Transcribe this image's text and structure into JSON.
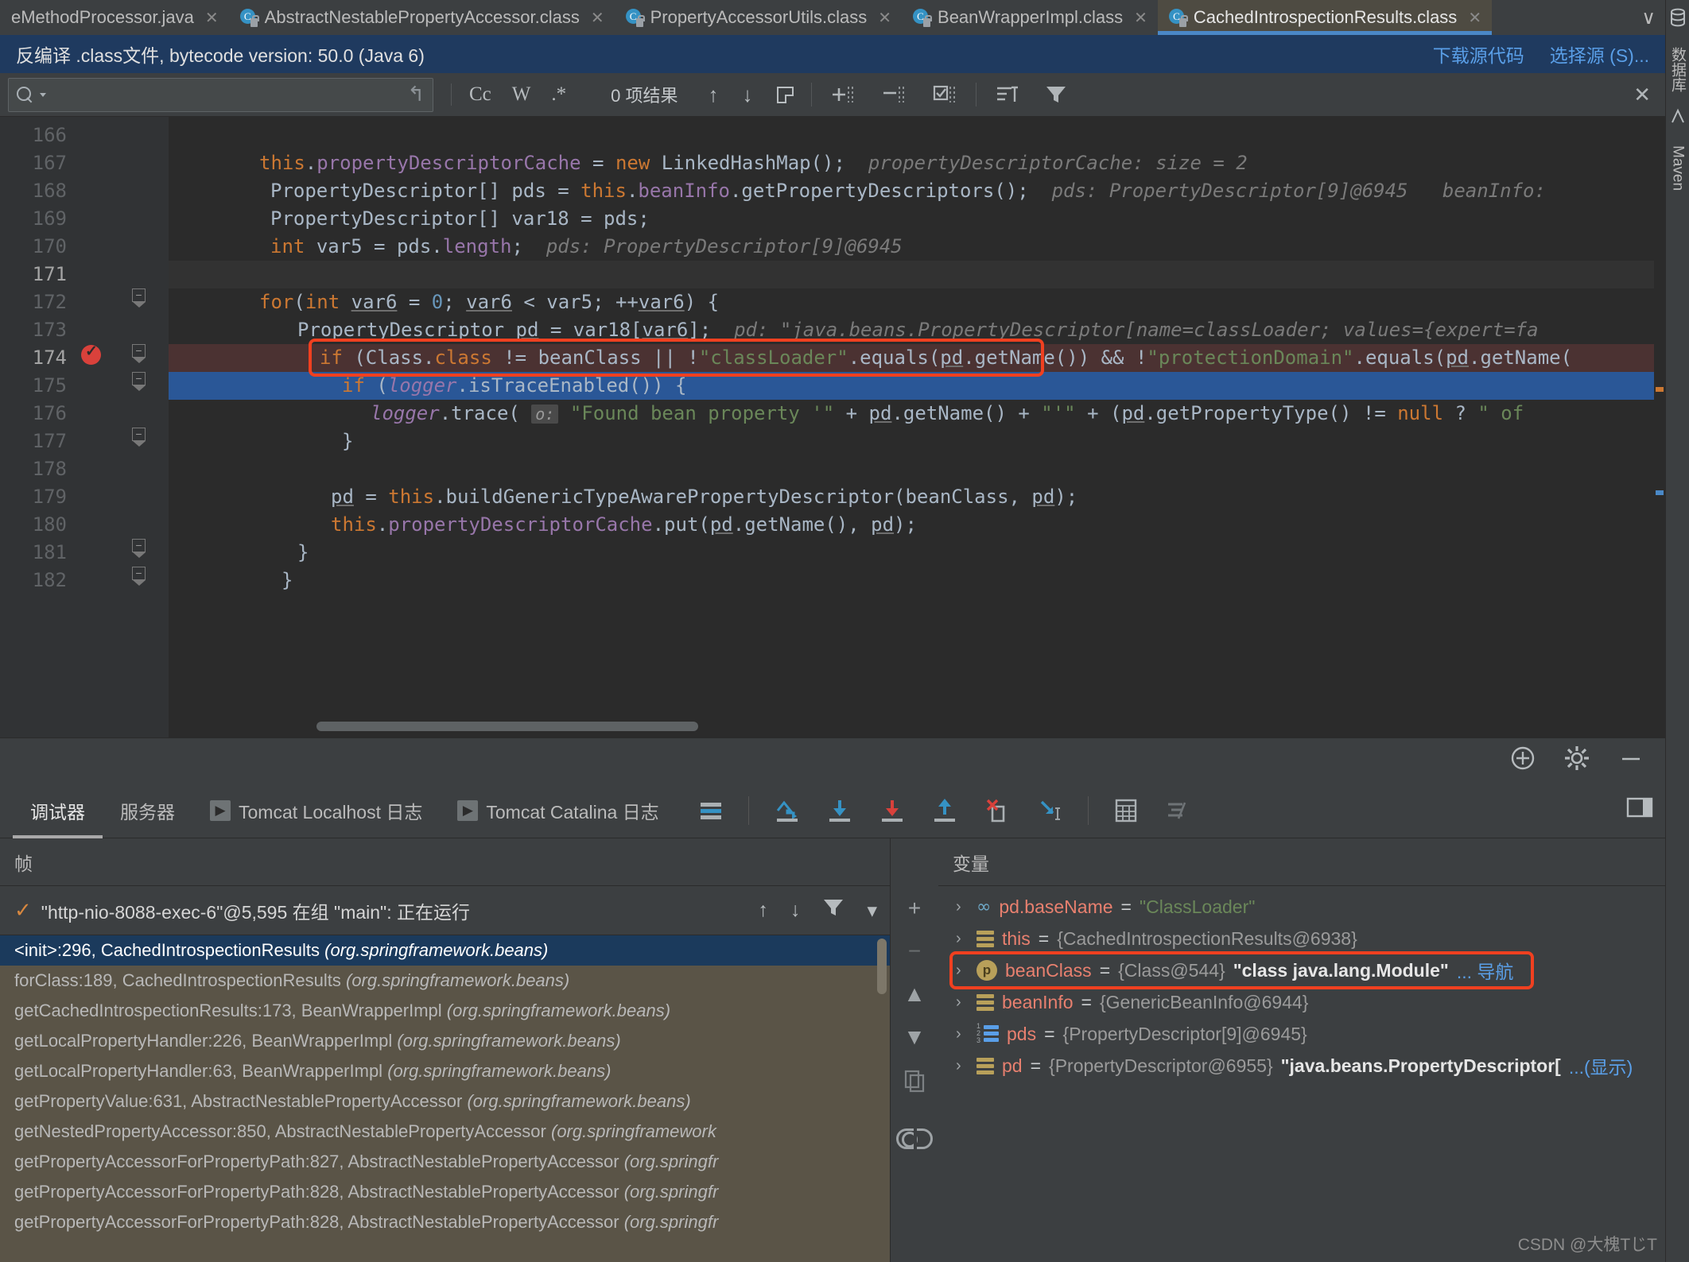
{
  "tabs": [
    {
      "label": "eMethodProcessor.java",
      "icon": "java-file-icon",
      "active": false,
      "hasIcon": false
    },
    {
      "label": "AbstractNestablePropertyAccessor.class",
      "icon": "class-file-icon",
      "active": false,
      "hasIcon": true
    },
    {
      "label": "PropertyAccessorUtils.class",
      "icon": "class-file-icon",
      "active": false,
      "hasIcon": true
    },
    {
      "label": "BeanWrapperImpl.class",
      "icon": "class-file-icon",
      "active": false,
      "hasIcon": true
    },
    {
      "label": "CachedIntrospectionResults.class",
      "icon": "class-file-icon",
      "active": true,
      "hasIcon": true
    }
  ],
  "tabbar": {
    "overflow_glyph": "∨",
    "close_glyph": "✕",
    "class_icon_letter": "C"
  },
  "notification": {
    "message": "反编译 .class文件, bytecode version: 50.0 (Java 6)",
    "actions": [
      "下载源代码",
      "选择源 (S)..."
    ]
  },
  "find": {
    "value": "",
    "placeholder": "",
    "wrap_glyph": "↰",
    "match_case": "Cc",
    "words": "W",
    "regex": ".*",
    "results": "0 项结果",
    "prev_glyph": "↑",
    "next_glyph": "↓",
    "select_all_glyph": "select-all-icon",
    "close_glyph": "✕"
  },
  "editor": {
    "first_line": 166,
    "lines": [
      {
        "n": 166,
        "html": "",
        "state": "normal"
      },
      {
        "n": 167,
        "html": "L167",
        "state": "normal"
      },
      {
        "n": 168,
        "html": "L168",
        "state": "normal"
      },
      {
        "n": 169,
        "html": "L169",
        "state": "normal"
      },
      {
        "n": 170,
        "html": "L170",
        "state": "normal"
      },
      {
        "n": 171,
        "html": "",
        "state": "cursor"
      },
      {
        "n": 172,
        "html": "L172",
        "state": "normal"
      },
      {
        "n": 173,
        "html": "L173",
        "state": "normal"
      },
      {
        "n": 174,
        "html": "L174",
        "state": "breakpoint"
      },
      {
        "n": 175,
        "html": "L175",
        "state": "executing"
      },
      {
        "n": 176,
        "html": "L176",
        "state": "normal"
      },
      {
        "n": 177,
        "html": "L177",
        "state": "normal"
      },
      {
        "n": 178,
        "html": "",
        "state": "normal"
      },
      {
        "n": 179,
        "html": "L179",
        "state": "normal"
      },
      {
        "n": 180,
        "html": "L180",
        "state": "normal"
      },
      {
        "n": 181,
        "html": "L181",
        "state": "normal"
      },
      {
        "n": 182,
        "html": "L182",
        "state": "normal"
      }
    ],
    "code_text": {
      "l167": "this.propertyDescriptorCache = new LinkedHashMap();",
      "l167_hint": "propertyDescriptorCache:  size = 2",
      "l168": "PropertyDescriptor[] pds = this.beanInfo.getPropertyDescriptors();",
      "l168_hint": "pds: PropertyDescriptor[9]@6945",
      "l168_hint2": "beanInfo:",
      "l169": "PropertyDescriptor[] var18 = pds;",
      "l170": "int var5 = pds.length;",
      "l170_hint": "pds: PropertyDescriptor[9]@6945",
      "l172": "for(int var6 = 0; var6 < var5; ++var6) {",
      "l173": "PropertyDescriptor pd = var18[var6];",
      "l173_hint": "pd: \"java.beans.PropertyDescriptor[name=classLoader; values={expert=fa",
      "l174": "if (Class.class != beanClass || !\"classLoader\".equals(pd.getName()) && !\"protectionDomain\".equals(pd.getName(",
      "l175": "if (logger.isTraceEnabled()) {",
      "l176": "logger.trace( o: \"Found bean property '\" + pd.getName() + \"'\" + (pd.getPropertyType() != null ? \" of",
      "l177": "}",
      "l179": "pd = this.buildGenericTypeAwarePropertyDescriptor(beanClass, pd);",
      "l180": "this.propertyDescriptorCache.put(pd.getName(), pd);",
      "l181": "}",
      "l182": "}"
    }
  },
  "debug": {
    "toolbar_icons": [
      "add-watch-icon",
      "settings-gear-icon",
      "minimize-icon"
    ],
    "tabs": [
      {
        "label": "调试器",
        "active": true,
        "icon": null
      },
      {
        "label": "服务器",
        "active": false,
        "icon": null
      },
      {
        "label": "Tomcat Localhost 日志",
        "active": false,
        "icon": "run-icon"
      },
      {
        "label": "Tomcat Catalina 日志",
        "active": false,
        "icon": "run-icon"
      }
    ],
    "step_tools": [
      "show-execution-point-icon",
      "step-over-icon",
      "step-into-icon",
      "force-step-into-icon",
      "step-out-icon",
      "drop-frame-icon",
      "run-to-cursor-icon",
      "evaluate-expression-icon",
      "mute-breakpoints-icon"
    ],
    "frames": {
      "header": "帧",
      "thread": "\"http-nio-8088-exec-6\"@5,595 在组 \"main\": 正在运行",
      "thread_tools": [
        "up-arrow-icon",
        "down-arrow-icon",
        "filter-icon",
        "dropdown-icon"
      ],
      "items": [
        {
          "text": "<init>:296, CachedIntrospectionResults ",
          "pkg": "(org.springframework.beans)",
          "selected": true
        },
        {
          "text": "forClass:189, CachedIntrospectionResults ",
          "pkg": "(org.springframework.beans)",
          "selected": false
        },
        {
          "text": "getCachedIntrospectionResults:173, BeanWrapperImpl ",
          "pkg": "(org.springframework.beans)",
          "selected": false
        },
        {
          "text": "getLocalPropertyHandler:226, BeanWrapperImpl ",
          "pkg": "(org.springframework.beans)",
          "selected": false
        },
        {
          "text": "getLocalPropertyHandler:63, BeanWrapperImpl ",
          "pkg": "(org.springframework.beans)",
          "selected": false
        },
        {
          "text": "getPropertyValue:631, AbstractNestablePropertyAccessor ",
          "pkg": "(org.springframework.beans)",
          "selected": false
        },
        {
          "text": "getNestedPropertyAccessor:850, AbstractNestablePropertyAccessor ",
          "pkg": "(org.springframework",
          "selected": false
        },
        {
          "text": "getPropertyAccessorForPropertyPath:827, AbstractNestablePropertyAccessor ",
          "pkg": "(org.springfr",
          "selected": false
        },
        {
          "text": "getPropertyAccessorForPropertyPath:828, AbstractNestablePropertyAccessor ",
          "pkg": "(org.springfr",
          "selected": false
        },
        {
          "text": "getPropertyAccessorForPropertyPath:828, AbstractNestablePropertyAccessor ",
          "pkg": "(org.springfr",
          "selected": false
        }
      ]
    },
    "variables": {
      "header": "变量",
      "toolbar": [
        "add-icon",
        "remove-icon",
        "move-up-icon",
        "move-down-icon",
        "copy-icon",
        "inspect-icon"
      ],
      "items": [
        {
          "icon": "infinity-icon",
          "name": "pd.baseName",
          "eq": "=",
          "value": "\"ClassLoader\"",
          "value_kind": "string",
          "suffix": "",
          "link": "",
          "highlighted": false
        },
        {
          "icon": "object-icon",
          "name": "this",
          "eq": "=",
          "value": "{CachedIntrospectionResults@6938}",
          "value_kind": "ref",
          "suffix": "",
          "link": "",
          "highlighted": false
        },
        {
          "icon": "parameter-icon",
          "name": "beanClass",
          "eq": "=",
          "value": "{Class@544}",
          "value_kind": "ref",
          "suffix": "\"class java.lang.Module\"",
          "link": "... 导航",
          "highlighted": true
        },
        {
          "icon": "object-icon",
          "name": "beanInfo",
          "eq": "=",
          "value": "{GenericBeanInfo@6944}",
          "value_kind": "ref",
          "suffix": "",
          "link": "",
          "highlighted": false
        },
        {
          "icon": "array-icon",
          "name": "pds",
          "eq": "=",
          "value": "{PropertyDescriptor[9]@6945}",
          "value_kind": "ref",
          "suffix": "",
          "link": "",
          "highlighted": false
        },
        {
          "icon": "object-icon",
          "name": "pd",
          "eq": "=",
          "value": "{PropertyDescriptor@6955}",
          "value_kind": "ref",
          "suffix": "\"java.beans.PropertyDescriptor[",
          "link": "...(显示)",
          "highlighted": false
        }
      ]
    }
  },
  "rightbar": {
    "items": [
      "数据库",
      "Maven"
    ]
  },
  "watermark": "CSDN @大槐TじT",
  "colors": {
    "accent_blue": "#4a88c7",
    "exec_line": "#2a5797",
    "breakpoint_line": "#4b3232",
    "annotation_red": "#f04020",
    "editor_bg": "#2b2b2b",
    "panel_bg": "#3c3f41",
    "frames_bg": "#5a5447",
    "notification_bg": "#1f3a5f"
  }
}
